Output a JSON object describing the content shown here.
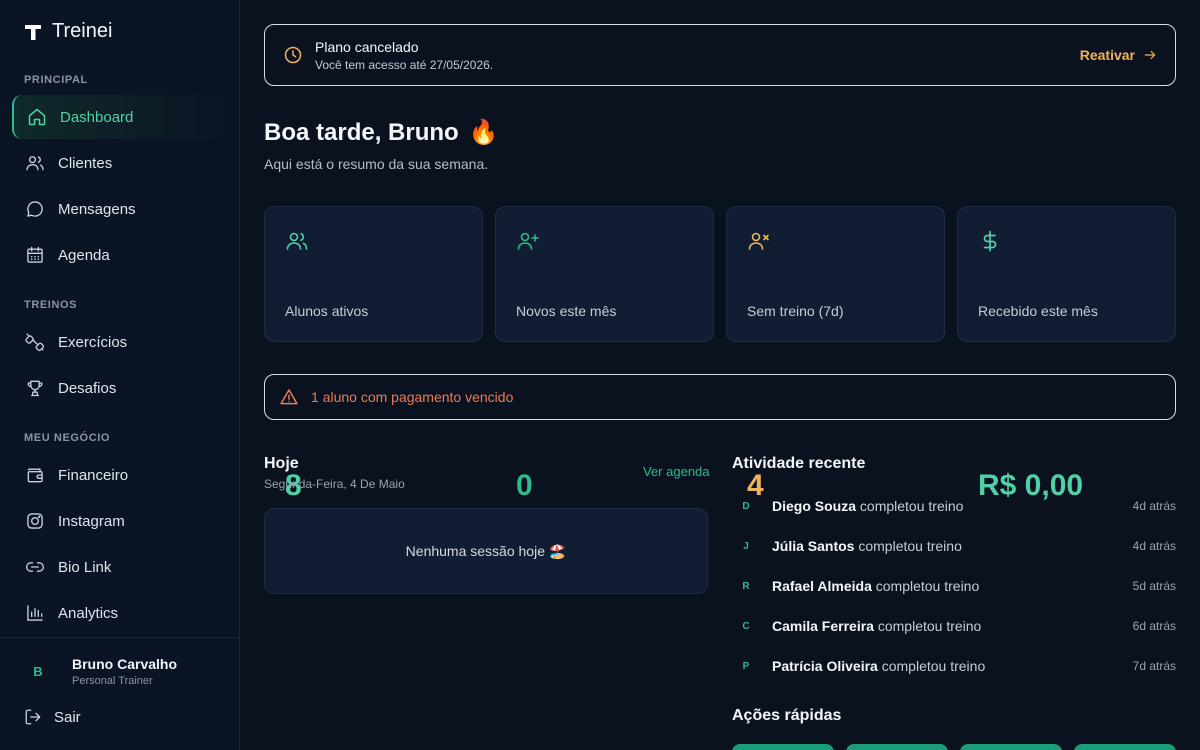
{
  "brand": {
    "name": "Treinei"
  },
  "sidebar": {
    "sections": [
      {
        "label": "PRINCIPAL"
      },
      {
        "label": "TREINOS"
      },
      {
        "label": "MEU NEGÓCIO"
      }
    ],
    "items": [
      {
        "label": "Dashboard",
        "icon": "home-icon",
        "active": true
      },
      {
        "label": "Clientes",
        "icon": "users-icon"
      },
      {
        "label": "Mensagens",
        "icon": "message-icon"
      },
      {
        "label": "Agenda",
        "icon": "calendar-icon"
      },
      {
        "label": "Exercícios",
        "icon": "dumbbell-icon"
      },
      {
        "label": "Desafios",
        "icon": "trophy-icon"
      },
      {
        "label": "Financeiro",
        "icon": "wallet-icon"
      },
      {
        "label": "Instagram",
        "icon": "instagram-icon"
      },
      {
        "label": "Bio Link",
        "icon": "link-icon"
      },
      {
        "label": "Analytics",
        "icon": "bar-chart-icon"
      }
    ],
    "user": {
      "initial": "B",
      "name": "Bruno Carvalho",
      "role": "Personal Trainer"
    },
    "logout_label": "Sair"
  },
  "banner": {
    "title": "Plano cancelado",
    "subtitle": "Você tem acesso até 27/05/2026.",
    "action": "Reativar"
  },
  "greeting": {
    "title": "Boa tarde, Bruno",
    "emoji": "🔥",
    "subtitle": "Aqui está o resumo da sua semana."
  },
  "stats": [
    {
      "value": "8",
      "label": "Alunos ativos",
      "icon": "users-icon",
      "color": "#4fd1a5"
    },
    {
      "value": "0",
      "label": "Novos este mês",
      "icon": "user-plus-icon",
      "color": "#2fb98d"
    },
    {
      "value": "4",
      "label": "Sem treino (7d)",
      "icon": "user-x-icon",
      "color": "#f0b35a"
    },
    {
      "value": "R$ 0,00",
      "label": "Recebido este mês",
      "icon": "dollar-icon",
      "color": "#4fd1a5"
    }
  ],
  "alert": {
    "text": "1 aluno com pagamento vencido",
    "icon": "warning-icon"
  },
  "today": {
    "title": "Hoje",
    "date": "Segunda-Feira, 4 De Maio",
    "see_agenda": "Ver agenda",
    "empty": "Nenhuma sessão hoje 🏖️"
  },
  "activity": {
    "title": "Atividade recente",
    "items": [
      {
        "initial": "D",
        "name": "Diego Souza",
        "action": "completou treino",
        "time": "4d atrás"
      },
      {
        "initial": "J",
        "name": "Júlia Santos",
        "action": "completou treino",
        "time": "4d atrás"
      },
      {
        "initial": "R",
        "name": "Rafael Almeida",
        "action": "completou treino",
        "time": "5d atrás"
      },
      {
        "initial": "C",
        "name": "Camila Ferreira",
        "action": "completou treino",
        "time": "6d atrás"
      },
      {
        "initial": "P",
        "name": "Patrícia Oliveira",
        "action": "completou treino",
        "time": "7d atrás"
      }
    ]
  },
  "quick_actions": {
    "title": "Ações rápidas"
  },
  "colors": {
    "accent": "#2fb98d",
    "warning": "#f0b35a",
    "danger": "#f07a52",
    "background": "#0a1220"
  }
}
